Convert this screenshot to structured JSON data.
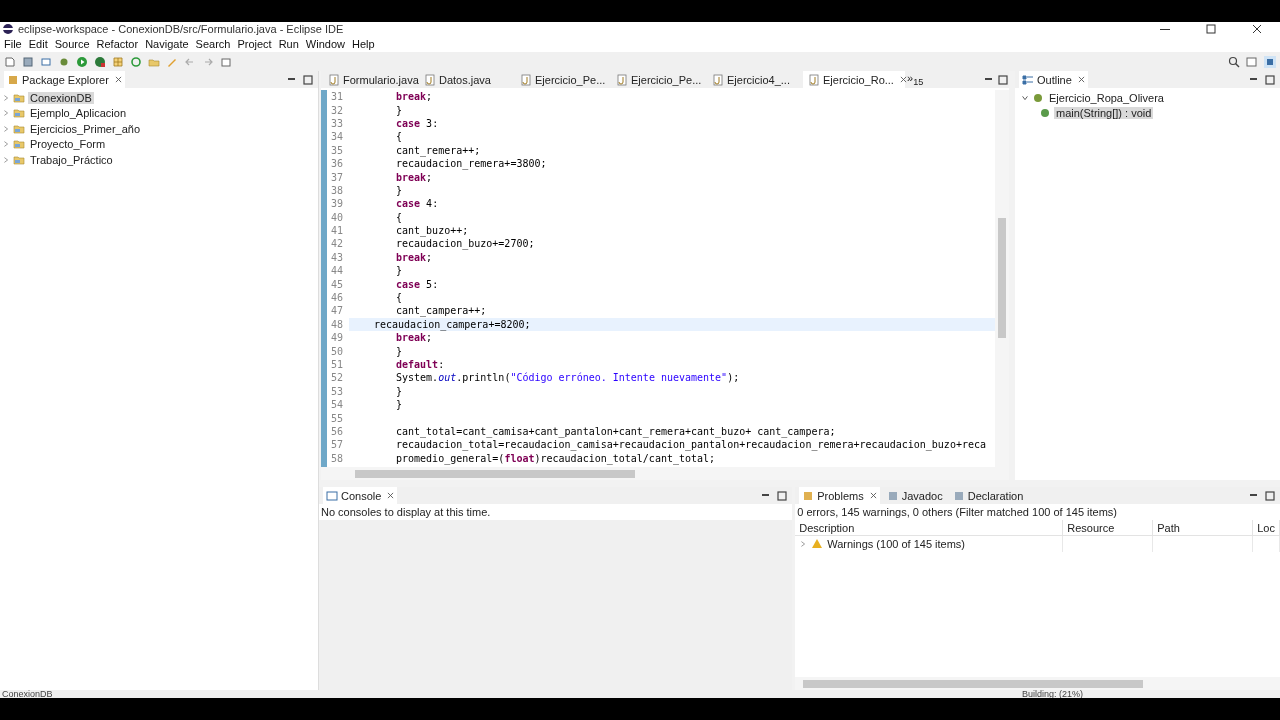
{
  "window": {
    "title": "eclipse-workspace - ConexionDB/src/Formulario.java - Eclipse IDE"
  },
  "menu": [
    "File",
    "Edit",
    "Source",
    "Refactor",
    "Navigate",
    "Search",
    "Project",
    "Run",
    "Window",
    "Help"
  ],
  "package_explorer": {
    "title": "Package Explorer",
    "projects": [
      {
        "name": "ConexionDB",
        "selected": true
      },
      {
        "name": "Ejemplo_Aplicacion",
        "selected": false
      },
      {
        "name": "Ejercicios_Primer_año",
        "selected": false
      },
      {
        "name": "Proyecto_Form",
        "selected": false
      },
      {
        "name": "Trabajo_Práctico",
        "selected": false
      }
    ]
  },
  "editor": {
    "tabs": [
      {
        "label": "Formulario.java",
        "selected": false
      },
      {
        "label": "Datos.java",
        "selected": false
      },
      {
        "label": "Ejercicio_Pe...",
        "selected": false
      },
      {
        "label": "Ejercicio_Pe...",
        "selected": false
      },
      {
        "label": "Ejercicio4_...",
        "selected": false
      },
      {
        "label": "Ejercicio_Ro...",
        "selected": true
      }
    ],
    "more_tabs": {
      "chevron": "»",
      "count": "15"
    },
    "lines": [
      {
        "number": "31",
        "current": false,
        "tokens": [
          {
            "kind": "keyword",
            "text": "break"
          },
          {
            "kind": "plain",
            "text": ";"
          }
        ]
      },
      {
        "number": "32",
        "current": false,
        "tokens": [
          {
            "kind": "plain",
            "text": "}"
          }
        ]
      },
      {
        "number": "33",
        "current": false,
        "tokens": [
          {
            "kind": "keyword",
            "text": "case"
          },
          {
            "kind": "plain",
            "text": " 3:"
          }
        ]
      },
      {
        "number": "34",
        "current": false,
        "tokens": [
          {
            "kind": "plain",
            "text": "{"
          }
        ]
      },
      {
        "number": "35",
        "current": false,
        "tokens": [
          {
            "kind": "plain",
            "text": "cant_remera++;"
          }
        ]
      },
      {
        "number": "36",
        "current": false,
        "tokens": [
          {
            "kind": "plain",
            "text": "recaudacion_remera+=3800;"
          }
        ]
      },
      {
        "number": "37",
        "current": false,
        "tokens": [
          {
            "kind": "keyword",
            "text": "break"
          },
          {
            "kind": "plain",
            "text": ";"
          }
        ]
      },
      {
        "number": "38",
        "current": false,
        "tokens": [
          {
            "kind": "plain",
            "text": "}"
          }
        ]
      },
      {
        "number": "39",
        "current": false,
        "tokens": [
          {
            "kind": "keyword",
            "text": "case"
          },
          {
            "kind": "plain",
            "text": " 4:"
          }
        ]
      },
      {
        "number": "40",
        "current": false,
        "tokens": [
          {
            "kind": "plain",
            "text": "{"
          }
        ]
      },
      {
        "number": "41",
        "current": false,
        "tokens": [
          {
            "kind": "plain",
            "text": "cant_buzo++;"
          }
        ]
      },
      {
        "number": "42",
        "current": false,
        "tokens": [
          {
            "kind": "plain",
            "text": "recaudacion_buzo+=2700;"
          }
        ]
      },
      {
        "number": "43",
        "current": false,
        "tokens": [
          {
            "kind": "keyword",
            "text": "break"
          },
          {
            "kind": "plain",
            "text": ";"
          }
        ]
      },
      {
        "number": "44",
        "current": false,
        "tokens": [
          {
            "kind": "plain",
            "text": "}"
          }
        ]
      },
      {
        "number": "45",
        "current": false,
        "tokens": [
          {
            "kind": "keyword",
            "text": "case"
          },
          {
            "kind": "plain",
            "text": " 5:"
          }
        ]
      },
      {
        "number": "46",
        "current": false,
        "tokens": [
          {
            "kind": "plain",
            "text": "{"
          }
        ]
      },
      {
        "number": "47",
        "current": false,
        "tokens": [
          {
            "kind": "plain",
            "text": "cant_campera++;"
          }
        ]
      },
      {
        "number": "48",
        "current": true,
        "tokens": [
          {
            "kind": "plain",
            "text": "recaudacion_campera+=8200;"
          }
        ]
      },
      {
        "number": "49",
        "current": false,
        "tokens": [
          {
            "kind": "keyword",
            "text": "break"
          },
          {
            "kind": "plain",
            "text": ";"
          }
        ]
      },
      {
        "number": "50",
        "current": false,
        "tokens": [
          {
            "kind": "plain",
            "text": "}"
          }
        ]
      },
      {
        "number": "51",
        "current": false,
        "tokens": [
          {
            "kind": "keyword",
            "text": "default"
          },
          {
            "kind": "plain",
            "text": ":"
          }
        ]
      },
      {
        "number": "52",
        "current": false,
        "tokens": [
          {
            "kind": "plain",
            "text": "System."
          },
          {
            "kind": "field",
            "text": "out"
          },
          {
            "kind": "plain",
            "text": ".println("
          },
          {
            "kind": "string",
            "text": "\"Código erróneo. Intente nuevamente\""
          },
          {
            "kind": "plain",
            "text": ");"
          }
        ]
      },
      {
        "number": "53",
        "current": false,
        "tokens": [
          {
            "kind": "plain",
            "text": "}"
          }
        ]
      },
      {
        "number": "54",
        "current": false,
        "tokens": [
          {
            "kind": "plain",
            "text": "}"
          }
        ]
      },
      {
        "number": "55",
        "current": false
      },
      {
        "number": "56",
        "current": false,
        "tokens": [
          {
            "kind": "plain",
            "text": "cant_total=cant_camisa+cant_pantalon+cant_remera+cant_buzo+ cant_campera;"
          }
        ]
      },
      {
        "number": "57",
        "current": false,
        "tokens": [
          {
            "kind": "plain",
            "text": "recaudacion_total=recaudacion_camisa+recaudacion_pantalon+recaudacion_remera+recaudacion_buzo+reca"
          }
        ]
      },
      {
        "number": "58",
        "current": false,
        "tokens": [
          {
            "kind": "plain",
            "text": "promedio_general=("
          },
          {
            "kind": "keyword",
            "text": "float"
          },
          {
            "kind": "plain",
            "text": ")recaudacion_total/cant_total;"
          }
        ]
      }
    ]
  },
  "outline": {
    "title": "Outline",
    "tree": [
      {
        "name": "Ejercicio_Ropa_Olivera",
        "expanded": true,
        "selected": false,
        "children": [
          {
            "name": "main(String[]) : void",
            "selected": true
          }
        ]
      }
    ]
  },
  "console": {
    "title": "Console",
    "message": "No consoles to display at this time."
  },
  "problems": {
    "tabs": [
      {
        "label": "Problems",
        "selected": true
      },
      {
        "label": "Javadoc",
        "selected": false
      },
      {
        "label": "Declaration",
        "selected": false
      }
    ],
    "summary": "0 errors, 145 warnings, 0 others (Filter matched 100 of 145 items)",
    "columns": [
      "Description",
      "Resource",
      "Path",
      "Loc"
    ],
    "rows": [
      {
        "description": "Warnings (100 of 145 items)",
        "expanded": false
      }
    ]
  },
  "status_bar": {
    "left": "ConexionDB",
    "right": "Building: (21%)"
  }
}
